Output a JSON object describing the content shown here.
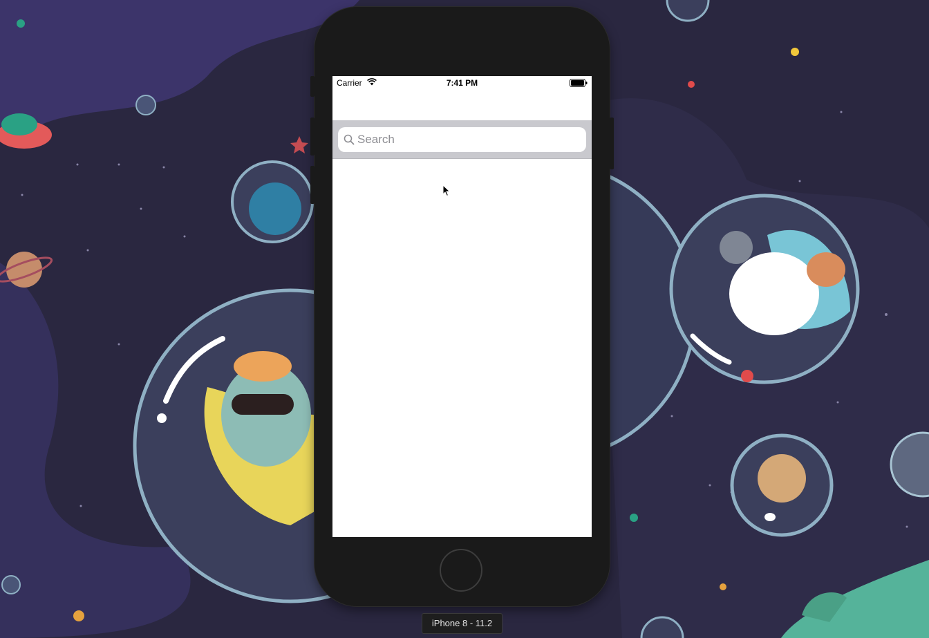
{
  "status_bar": {
    "carrier": "Carrier",
    "time": "7:41 PM",
    "wifi_icon": "wifi-icon",
    "battery_icon": "battery-full-icon"
  },
  "search": {
    "placeholder": "Search",
    "value": "",
    "icon": "magnifying-glass-icon"
  },
  "simulator": {
    "device_label": "iPhone 8 - 11.2"
  },
  "colors": {
    "wallpaper": "#2a2740",
    "phone_body": "#1a1a1a",
    "search_bar_bg": "#c9c9ce",
    "search_field_bg": "#ffffff",
    "placeholder": "#8e8e93"
  }
}
